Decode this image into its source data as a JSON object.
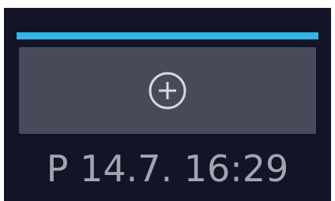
{
  "colors": {
    "background": "#131428",
    "accent_bar": "#33b5e5",
    "card": "#484a5a",
    "icon": "#d8d8de",
    "text": "#a3a4ae"
  },
  "add_button": {
    "icon": "plus-circle-icon"
  },
  "footer": {
    "timestamp": "P 14.7. 16:29"
  }
}
